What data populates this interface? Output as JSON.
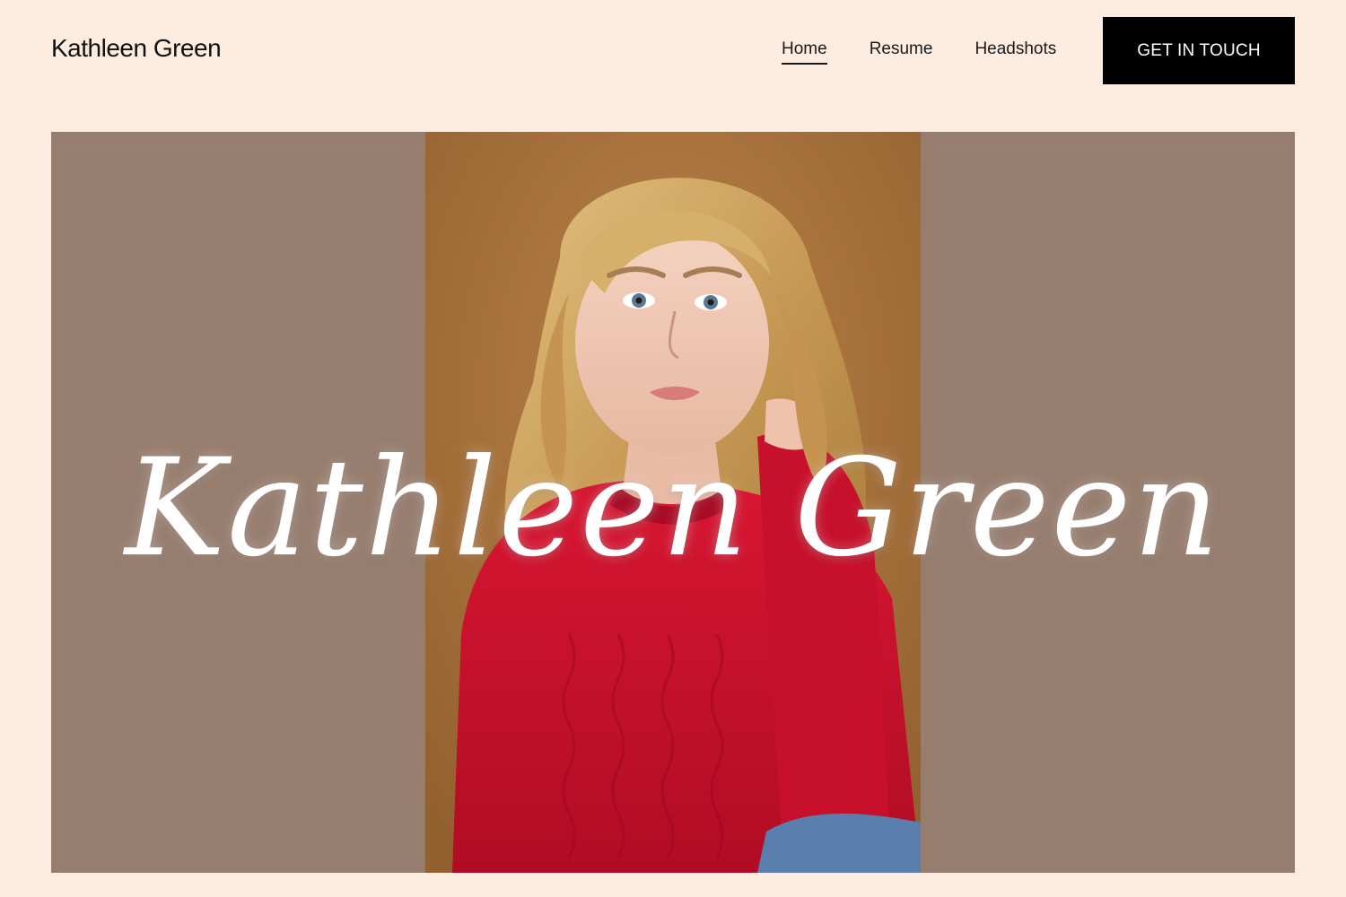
{
  "header": {
    "brand": "Kathleen Green",
    "nav": [
      {
        "label": "Home",
        "active": true
      },
      {
        "label": "Resume",
        "active": false
      },
      {
        "label": "Headshots",
        "active": false
      }
    ],
    "cta_label": "GET IN TOUCH"
  },
  "hero": {
    "script_title": "Kathleen Green",
    "photo_subject": "headshot-photo",
    "colors": {
      "page_background": "#fdece0",
      "hero_background": "#967d6e",
      "photo_backdrop": "#a8733f",
      "sweater": "#c8102e",
      "cta_background": "#000000"
    }
  }
}
